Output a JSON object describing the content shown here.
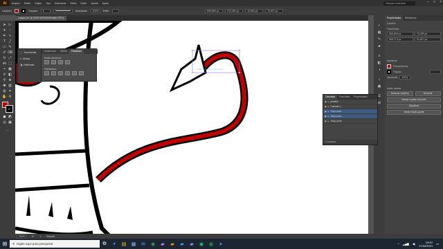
{
  "app": {
    "logo": "Ai",
    "menu": [
      "Arquivo",
      "Editar",
      "Objeto",
      "Tipo",
      "Selecionar",
      "Efeito",
      "Exibir",
      "Janela",
      "Ajuda"
    ],
    "search_label": "Clássico essencial"
  },
  "control_bar": {
    "selection_label": "Caminho",
    "stroke_label": "Traçado:",
    "opacity_label": "Opacidade:",
    "opacity_value": "100%",
    "style_label": "Estilo:",
    "x_value": "606,899 px",
    "y_value": "313,252 px",
    "w_value": "10,684 px",
    "h_value": "70,627 px",
    "fill_color": "#c00000",
    "stroke_color": "#000000"
  },
  "document": {
    "tab_title": "chapéu.ai* @ 200% (RGB/Definição GPU)"
  },
  "transform_panel": {
    "sidebar": [
      "Transformar",
      "Alinhar",
      "Pathfinder"
    ],
    "tabs": [
      "Transformar",
      "Alinhar",
      "Pathfinder"
    ],
    "shape_modes_label": "Modos de forma:",
    "pathfinders_label": "Pathfinders:"
  },
  "properties_panel": {
    "tabs": [
      "Propriedades",
      "Bibliotecas"
    ],
    "section_path": "Caminho",
    "section_transform": "Transformar",
    "x": "606,899 px",
    "y": "70,289 px",
    "w": "505,713 px",
    "h": "91,627 px",
    "section_appearance": "Aparência",
    "fill_label": "Preenchimento",
    "stroke_label": "Traçado",
    "opacity_label": "Opacidade",
    "opacity_value": "100%",
    "quick_actions_label": "Ações rápidas",
    "btn_offset": "Deslocar caminho",
    "btn_recolor": "Recolorir",
    "btn_simplify": "Simplificar",
    "btn_align": "Alinhar à grade de pixels",
    "btn_global": "Iniciar Edição global",
    "fill_color": "#c00000"
  },
  "layers_panel": {
    "tabs": [
      "Camadas",
      "Prancheta",
      "Propriedades"
    ],
    "rows": [
      {
        "name": "pêndulo",
        "selected": false
      },
      {
        "name": "Camada 1...",
        "selected": false
      },
      {
        "name": "Traço (sub...",
        "selected": true
      },
      {
        "name": "Traço (sub...",
        "selected": true
      },
      {
        "name": "Traço (sub)",
        "selected": false
      }
    ],
    "footer": "3 Camadas"
  },
  "status_bar": {
    "zoom": "200%",
    "rotation": "0°",
    "artboard": "1",
    "tool": "Seleção"
  },
  "taskbar": {
    "search_placeholder": "Digite aqui para pesquisar",
    "time": "09:57",
    "date": "27/02/2021",
    "apps": [
      "task-view-icon",
      "edge-icon",
      "explorer-icon",
      "store-icon",
      "mail-icon",
      "chrome-icon",
      "premiere-icon",
      "illustrator-icon",
      "photoshop-icon",
      "aftereffects-icon",
      "spotify-icon",
      "whatsapp-icon",
      "telegram-icon"
    ]
  }
}
